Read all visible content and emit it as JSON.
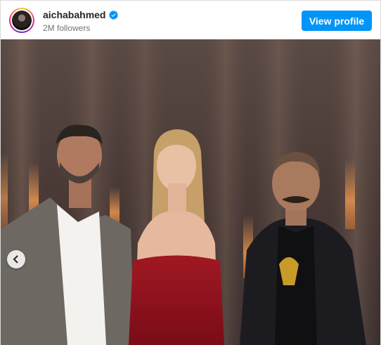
{
  "header": {
    "username": "aichabahmed",
    "verified_icon": "verified-badge-icon",
    "followers": "2M followers",
    "view_profile_label": "View profile"
  },
  "post": {
    "image_alt": "aichabahmed post photo",
    "carousel": {
      "prev_icon": "chevron-left-icon"
    }
  },
  "colors": {
    "accent": "#0095f6",
    "verified": "#0095f6",
    "text_primary": "#262626",
    "text_secondary": "#737373"
  }
}
